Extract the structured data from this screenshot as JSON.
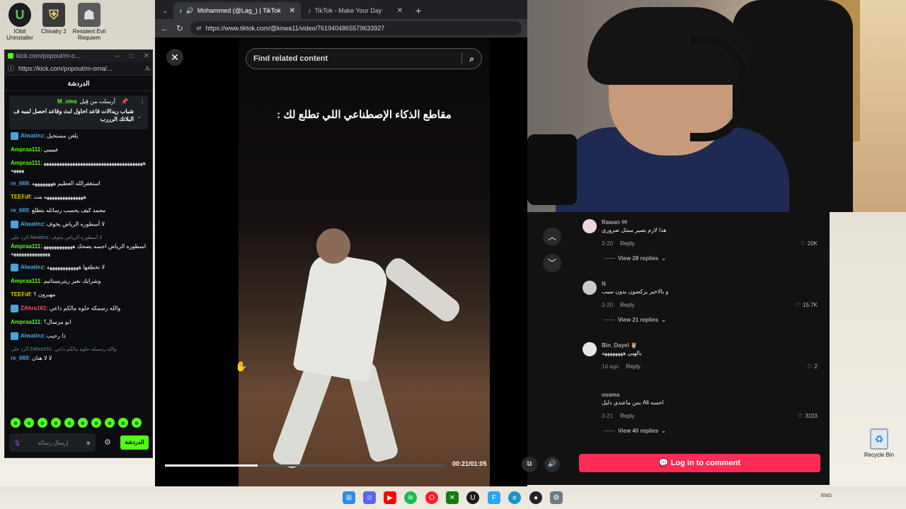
{
  "desktop": {
    "icons": [
      {
        "label": "IObit Uninstaller"
      },
      {
        "label": "Chivalry 2"
      },
      {
        "label": "Resident Evil Requiem"
      }
    ],
    "recycle_bin": "Recycle Bin"
  },
  "kick_window": {
    "url_short": "kick.com/popout/m-o...",
    "url_full": "https://kick.com/popout/m-oma/...",
    "header": "الدردشة",
    "pinned": {
      "sent_by": "أرسلت من قِبل",
      "user": "M_oma",
      "message": "شباب ريدالات قاعد احاول ابث وقاعد احصل لمبه ف البلاتك الرررب"
    },
    "messages": [
      {
        "user": "Alwatinz",
        "color": "#4aa3df",
        "badge": true,
        "text": "يلعن مستحيل"
      },
      {
        "user": "Ampraa111",
        "color": "#53fc18",
        "badge": false,
        "text": "عييييي"
      },
      {
        "user": "Ampraa111",
        "color": "#53fc18",
        "badge": false,
        "text": "هههههههههههههههههههههههههههههههههههههههههههه"
      },
      {
        "user": "re_669",
        "color": "#4aa3df",
        "badge": false,
        "text": "استغفرالله العظيم ههههههههه"
      },
      {
        "user": "TEEFdf",
        "color": "#e8c400",
        "badge": false,
        "text": "هههههههههههههههه مت"
      },
      {
        "user": "re_669",
        "color": "#4aa3df",
        "badge": false,
        "text": "محمد كيف يحسب رسائله بتطلع"
      },
      {
        "user": "Alwatinz",
        "color": "#4aa3df",
        "badge": true,
        "text": "لا أسطوره الرياض يخوف"
      },
      {
        "reply": true,
        "text": "الرد على Alwatinz: لا أسطوره الرياض يخوف"
      },
      {
        "user": "Ampraa111",
        "color": "#53fc18",
        "badge": false,
        "text": "اسطوره الرياض احسه يضحك ههههههههههههههههههههههههههه"
      },
      {
        "user": "Alwatinz",
        "color": "#4aa3df",
        "badge": true,
        "text": "لا تخطفها ههههههههههههه"
      },
      {
        "user": "Ampraa111",
        "color": "#53fc18",
        "badge": false,
        "text": "وشرايك نغير ريتربستاتيم"
      },
      {
        "user": "TEEFdf",
        "color": "#e8c400",
        "badge": false,
        "text": "مهيرون ؟"
      },
      {
        "user": "ZAhra161",
        "color": "#ff4d6a",
        "badge": true,
        "text": "والله رسمكه حلوه مالكم داعي"
      },
      {
        "user": "Ampraa111",
        "color": "#53fc18",
        "badge": false,
        "text": "ابو مرسال؟"
      },
      {
        "user": "Alwatinz",
        "color": "#4aa3df",
        "badge": true,
        "text": "ذا رحيب"
      },
      {
        "reply": true,
        "text": "الرد على ZAhra161: والله رسمكه حلوه مالكم داعي"
      },
      {
        "user": "re_669",
        "color": "#4aa3df",
        "badge": false,
        "text": "لا لا هنان"
      }
    ],
    "input_placeholder": "إرسال رسالة",
    "send_label": "الدردشة"
  },
  "browser": {
    "tabs": [
      {
        "title": "Mohammed (@Lag_) | TikTok",
        "active": true
      },
      {
        "title": "TikTok - Make Your Day",
        "active": false
      }
    ],
    "url": "https://www.tiktok.com/@knwa11/video/7619404865579633927"
  },
  "tiktok": {
    "search_placeholder": "Find related content",
    "caption": "مقاطع الذكاء الإصطناعي اللي تطلع لك :",
    "time": "00:21/01:05",
    "progress_fraction": 0.33,
    "comments": [
      {
        "name": "Rawan ୨୧",
        "text": "هذا لازم يصير ممثل ضروري",
        "date": "3-20",
        "reply": "Reply",
        "likes": "20K",
        "replies": "View 28 replies",
        "avatar": "#f0d6dd"
      },
      {
        "name": "N",
        "text": "و بالاخير يركضون بدون سبب",
        "date": "3-20",
        "reply": "Reply",
        "likes": "15.7K",
        "replies": "View 21 replies",
        "avatar": "#c9c9c9"
      },
      {
        "name": "Bin_Dayel 🦉",
        "text": "يالهيي ههههههههه",
        "date": "1d ago",
        "reply": "Reply",
        "likes": "2",
        "replies": "",
        "avatar": "#dfe9df"
      },
      {
        "name": "osama",
        "text": "احسه Ali بس ماعندي دليل",
        "date": "3-21",
        "reply": "Reply",
        "likes": "3103",
        "replies": "View 40 replies",
        "avatar": "#111111"
      }
    ],
    "login_label": "Log in to comment"
  },
  "colors": {
    "kick_green": "#53fc18",
    "tiktok_red": "#fe2c55"
  }
}
